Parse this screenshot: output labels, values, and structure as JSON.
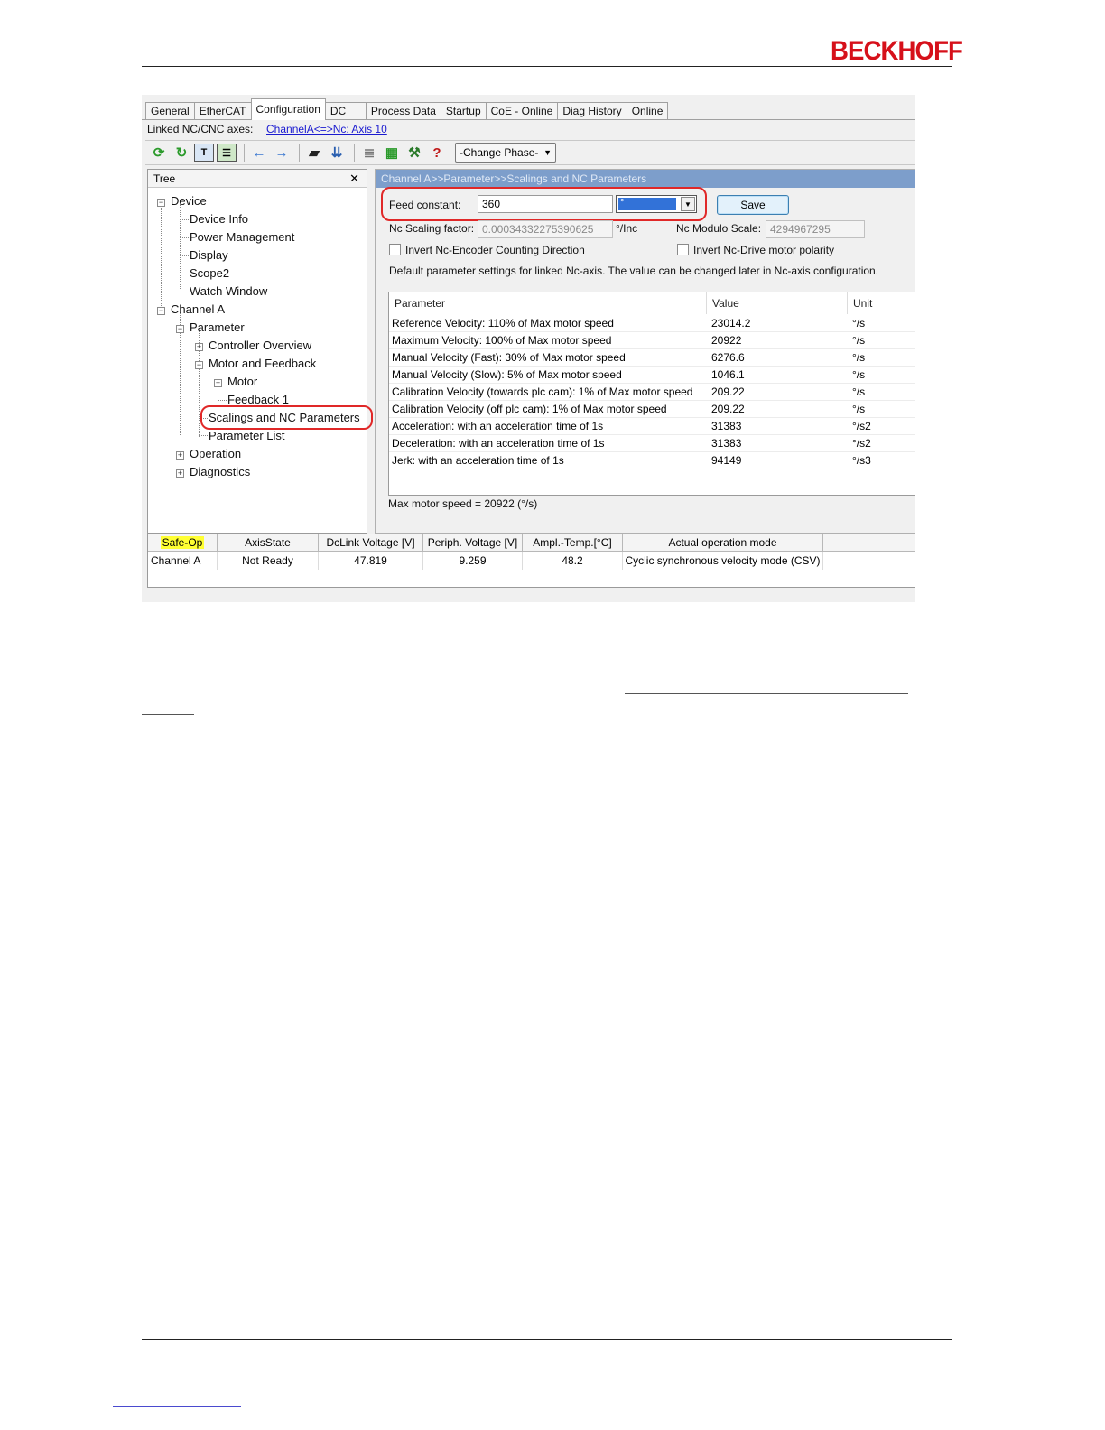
{
  "brand": {
    "logo_text": "BECKHOFF",
    "logo_color": "#d6101a"
  },
  "tabs": [
    "General",
    "EtherCAT",
    "Configuration",
    "DC",
    "Process Data",
    "Startup",
    "CoE - Online",
    "Diag History",
    "Online"
  ],
  "active_tab": "Configuration",
  "linked": {
    "label": "Linked NC/CNC axes:",
    "link_text": "ChannelA<=>Nc: Axis 10"
  },
  "toolbar": {
    "icons": [
      "refresh-green-icon",
      "refresh-alt-icon",
      "tree-view-icon",
      "grid-view-icon",
      "back-arrow-icon",
      "forward-arrow-icon",
      "comment-icon",
      "download-icon",
      "list-icon",
      "export-icon",
      "tools-icon",
      "help-icon"
    ],
    "help_glyph": "?",
    "phase_label": "-Change Phase-"
  },
  "tree": {
    "header": "Tree",
    "close_glyph": "✕",
    "items": {
      "device": "Device",
      "device_info": "Device Info",
      "power_management": "Power Management",
      "display": "Display",
      "scope2": "Scope2",
      "watch_window": "Watch Window",
      "channel_a": "Channel A",
      "parameter": "Parameter",
      "controller_overview": "Controller Overview",
      "motor_and_feedback": "Motor and Feedback",
      "motor": "Motor",
      "feedback1": "Feedback 1",
      "scalings": "Scalings and NC Parameters",
      "parameter_list": "Parameter List",
      "operation": "Operation",
      "diagnostics": "Diagnostics"
    }
  },
  "panel": {
    "breadcrumb": "Channel A>>Parameter>>Scalings and NC Parameters",
    "feed_constant_label": "Feed constant:",
    "feed_constant_value": "360",
    "unit_selected": "°",
    "save_label": "Save",
    "nc_scaling_label": "Nc Scaling factor:",
    "nc_scaling_value": "0.00034332275390625",
    "nc_scaling_unit": "°/Inc",
    "nc_modulo_label": "Nc Modulo Scale:",
    "nc_modulo_value": "4294967295",
    "invert_encoder_label": "Invert Nc-Encoder Counting Direction",
    "invert_drive_label": "Invert Nc-Drive motor polarity",
    "default_note": "Default parameter settings for linked Nc-axis. The value can be changed later in Nc-axis configuration.",
    "max_speed_note": "Max motor speed = 20922 (°/s)"
  },
  "param_table": {
    "headers": [
      "Parameter",
      "Value",
      "Unit"
    ],
    "rows": [
      [
        "Reference Velocity: 110% of Max motor speed",
        "23014.2",
        "°/s"
      ],
      [
        "Maximum Velocity: 100% of Max motor speed",
        "20922",
        "°/s"
      ],
      [
        "Manual Velocity (Fast): 30% of Max motor speed",
        "6276.6",
        "°/s"
      ],
      [
        "Manual Velocity (Slow): 5% of Max motor speed",
        "1046.1",
        "°/s"
      ],
      [
        "Calibration Velocity (towards plc cam): 1% of Max motor speed",
        "209.22",
        "°/s"
      ],
      [
        "Calibration Velocity (off plc cam): 1% of Max motor speed",
        "209.22",
        "°/s"
      ],
      [
        "Acceleration: with an acceleration time of 1s",
        "31383",
        "°/s2"
      ],
      [
        "Deceleration: with an acceleration time of 1s",
        "31383",
        "°/s2"
      ],
      [
        "Jerk: with an acceleration time of 1s",
        "94149",
        "°/s3"
      ]
    ]
  },
  "status": {
    "headers": [
      "Safe-Op",
      "AxisState",
      "DcLink Voltage [V]",
      "Periph. Voltage [V]",
      "Ampl.-Temp.[°C]",
      "Actual operation mode"
    ],
    "row": [
      "Channel A",
      "Not Ready",
      "47.819",
      "9.259",
      "48.2",
      "Cyclic synchronous velocity mode (CSV)"
    ]
  }
}
